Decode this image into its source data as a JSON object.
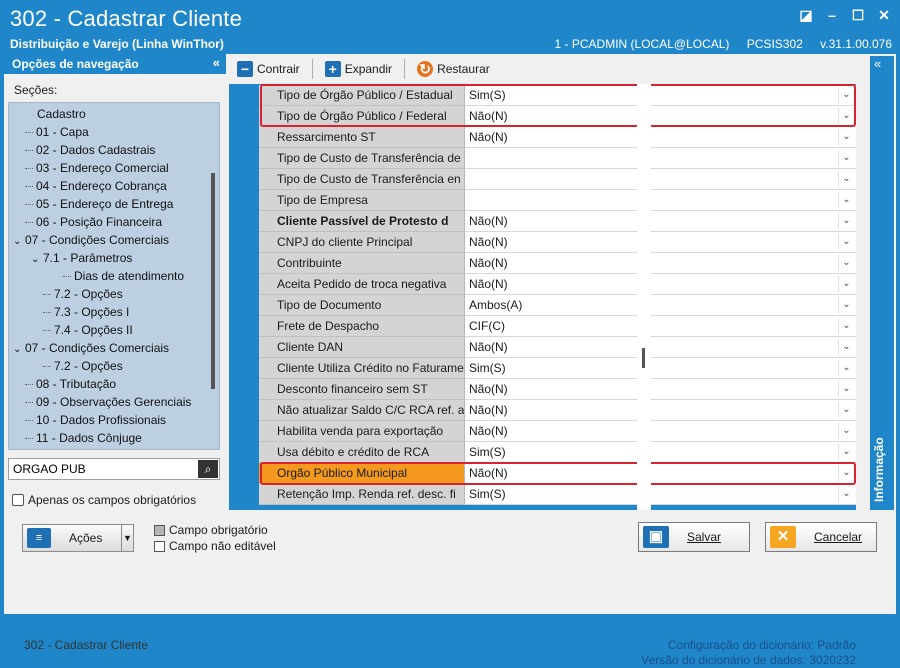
{
  "window": {
    "title": "302 - Cadastrar Cliente",
    "subtitle": "Distribuição e Varejo (Linha WinThor)",
    "user": "1 - PCADMIN (LOCAL@LOCAL)",
    "module": "PCSIS302",
    "version": "v.31.1.00.076",
    "controls": {
      "restore": "◪",
      "minimize": "–",
      "maximize": "☐",
      "close": "✕"
    }
  },
  "nav": {
    "header": "Opções de navegação",
    "collapse": "«",
    "sections_label": "Seções:",
    "items": [
      {
        "label": "Cadastro",
        "level": 0
      },
      {
        "label": "01 - Capa",
        "level": 1
      },
      {
        "label": "02 - Dados Cadastrais",
        "level": 1
      },
      {
        "label": "03 - Endereço Comercial",
        "level": 1
      },
      {
        "label": "04 - Endereço Cobrança",
        "level": 1
      },
      {
        "label": "05 - Endereço de Entrega",
        "level": 1
      },
      {
        "label": "06 - Posição Financeira",
        "level": 1
      },
      {
        "label": "07 - Condições Comerciais",
        "level": 1,
        "expanded": true
      },
      {
        "label": "7.1 - Parâmetros",
        "level": 2,
        "expanded": true
      },
      {
        "label": "Dias de atendimento",
        "level": 3
      },
      {
        "label": "7.2 - Opções",
        "level": 2
      },
      {
        "label": "7.3 - Opções I",
        "level": 2
      },
      {
        "label": "7.4 - Opções II",
        "level": 2
      },
      {
        "label": "07 - Condições Comerciais",
        "level": 1,
        "expanded": true
      },
      {
        "label": "7.2 - Opções",
        "level": 2
      },
      {
        "label": "08 - Tributação",
        "level": 1
      },
      {
        "label": "09 - Observações Gerenciais",
        "level": 1
      },
      {
        "label": "10 - Dados Profissionais",
        "level": 1
      },
      {
        "label": "11 - Dados Cônjuge",
        "level": 1
      }
    ],
    "search_value": "ORGAO PUB",
    "only_required_label": "Apenas os campos obrigatórios"
  },
  "toolbar": {
    "collapse_label": "Contrair",
    "expand_label": "Expandir",
    "restore_label": "Restaurar"
  },
  "grid": {
    "rows": [
      {
        "label": "Tipo de Órgão Público / Estadual",
        "value": "Sim(S)"
      },
      {
        "label": "Tipo de Órgão Público / Federal",
        "value": "Não(N)"
      },
      {
        "label": "Ressarcimento ST",
        "value": "Não(N)"
      },
      {
        "label": "Tipo de Custo de Transferência de",
        "value": ""
      },
      {
        "label": "Tipo de Custo de Transferência en",
        "value": ""
      },
      {
        "label": "Tipo de Empresa",
        "value": ""
      },
      {
        "label": "Cliente Passível de Protesto d",
        "value": "Não(N)",
        "bold": true
      },
      {
        "label": "CNPJ do cliente Principal",
        "value": "Não(N)"
      },
      {
        "label": "Contribuinte",
        "value": "Não(N)"
      },
      {
        "label": "Aceita Pedido de troca negativa",
        "value": "Não(N)"
      },
      {
        "label": "Tipo de Documento",
        "value": "Ambos(A)"
      },
      {
        "label": "Frete de Despacho",
        "value": "CIF(C)"
      },
      {
        "label": "Cliente DAN",
        "value": "Não(N)"
      },
      {
        "label": "Cliente Utiliza Crédito no Faturame",
        "value": "Sim(S)"
      },
      {
        "label": "Desconto financeiro sem ST",
        "value": "Não(N)"
      },
      {
        "label": "Não atualizar Saldo C/C RCA ref. a",
        "value": "Não(N)"
      },
      {
        "label": "Habilita venda para exportação",
        "value": "Não(N)"
      },
      {
        "label": "Usa débito e crédito de RCA",
        "value": "Sim(S)"
      },
      {
        "label": "Orgão Público Municipal",
        "value": "Não(N)",
        "orange": true
      },
      {
        "label": "Retenção Imp. Renda ref. desc. fi",
        "value": "Sim(S)"
      }
    ]
  },
  "info_panel": {
    "label": "Informação",
    "collapse": "«"
  },
  "bottom": {
    "actions_label": "Ações",
    "legend_required": "Campo obrigatório",
    "legend_not_editable": "Campo não editável",
    "save_label": "Salvar",
    "cancel_label": "Cancelar"
  },
  "footer": {
    "left": "302 - Cadastrar Cliente",
    "dict_config_label": "Configuração do dicionário:",
    "dict_config_value": "Padrão",
    "dict_version_label": "Versão do dicionário de dados:",
    "dict_version_value": "3020232"
  },
  "colors": {
    "title_blue": "#1f87c9",
    "tree_bg": "#bcd0e2",
    "highlight_red": "#d9232e",
    "highlight_orange": "#f59a1f"
  }
}
